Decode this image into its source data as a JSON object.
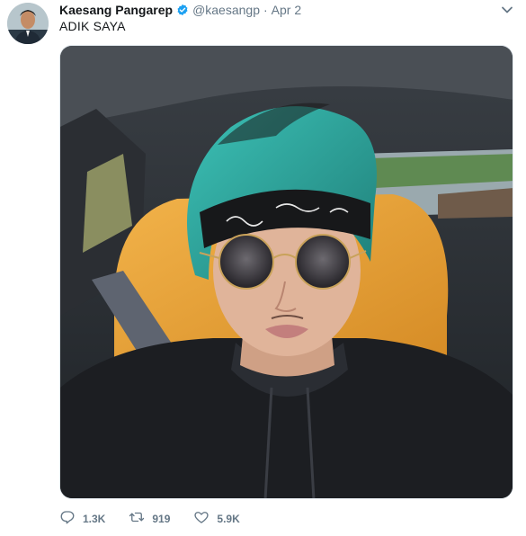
{
  "user": {
    "name": "Kaesang Pangarep",
    "handle": "@kaesangp",
    "separator": "·",
    "date": "Apr 2",
    "verified": true
  },
  "tweet": {
    "text": "ADIK SAYA"
  },
  "actions": {
    "replies": "1.3K",
    "retweets": "919",
    "likes": "5.9K"
  },
  "colors": {
    "text": "#14171a",
    "secondary": "#657786",
    "verified": "#1da1f2",
    "seat": "#e8a33a",
    "hair": "#2fa8a0",
    "hoodie": "#1c1e22"
  },
  "icons": {
    "caret": "chevron-down-icon",
    "verified": "verified-badge-icon",
    "reply": "reply-icon",
    "retweet": "retweet-icon",
    "like": "heart-icon"
  }
}
